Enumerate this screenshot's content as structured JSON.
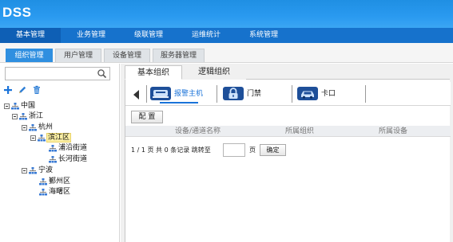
{
  "app": {
    "title": "DSS"
  },
  "nav": {
    "items": [
      "基本管理",
      "业务管理",
      "级联管理",
      "运维统计",
      "系统管理"
    ],
    "active": 0
  },
  "subtabs": {
    "items": [
      "组织管理",
      "用户管理",
      "设备管理",
      "服务器管理"
    ],
    "active": 0
  },
  "search": {
    "value": "",
    "placeholder": "",
    "icon": "search-icon"
  },
  "toolbar": {
    "add_icon": "add-icon",
    "edit_icon": "edit-icon",
    "delete_icon": "delete-icon"
  },
  "tree": {
    "nodes": [
      {
        "label": "中国",
        "level": 0,
        "expanded": true
      },
      {
        "label": "浙江",
        "level": 1,
        "expanded": true
      },
      {
        "label": "杭州",
        "level": 2,
        "expanded": true
      },
      {
        "label": "滨江区",
        "level": 3,
        "expanded": true,
        "selected": true
      },
      {
        "label": "浦沿街道",
        "level": 4
      },
      {
        "label": "长河街道",
        "level": 4
      },
      {
        "label": "宁波",
        "level": 2,
        "expanded": true
      },
      {
        "label": "鄞州区",
        "level": 3
      },
      {
        "label": "海曙区",
        "level": 3
      }
    ]
  },
  "main_tabs": {
    "items": [
      "基本组织",
      "逻辑组织"
    ],
    "active": 0
  },
  "device_types": {
    "items": [
      {
        "label": "报警主机",
        "icon": "alarm-host-icon",
        "color": "#2a6ab8",
        "active": true
      },
      {
        "label": "门禁",
        "icon": "access-control-lock-icon",
        "color": "#2a6ab8"
      },
      {
        "label": "卡口",
        "icon": "checkpoint-car-icon",
        "color": "#2a6ab8"
      }
    ]
  },
  "config_button": {
    "label": "配 置"
  },
  "table": {
    "columns": [
      "设备/通道名称",
      "所属组织",
      "所属设备"
    ],
    "rows": []
  },
  "pager": {
    "summary": "1 / 1 页 共 0 条记录 跳转至",
    "page_value": "",
    "page_unit": "页",
    "confirm_label": "确定"
  },
  "colors": {
    "header": "#2a9af0",
    "nav": "#1672cc",
    "accent": "#2f8fe0",
    "selected_node": "#fdf1a6"
  }
}
